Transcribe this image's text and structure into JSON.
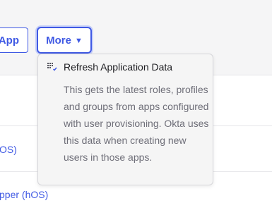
{
  "toolbar": {
    "app_button_label": "App",
    "more_button_label": "More",
    "more_caret": "▼"
  },
  "rows": [
    {
      "label": "OS)"
    },
    {
      "label": "pper (hOS)"
    }
  ],
  "dropdown": {
    "item": {
      "icon": "refresh-data-icon",
      "title": "Refresh Application Data",
      "description": "This gets the latest roles, profiles and groups from apps configured with user provisioning. Okta uses this data when creating new users in those apps."
    }
  },
  "colors": {
    "accent": "#3f59e4",
    "header_bg": "#f5f5f6",
    "dropdown_bg": "#f5f5f5",
    "text_primary": "#1d1d21",
    "text_muted": "#6e6e78"
  }
}
